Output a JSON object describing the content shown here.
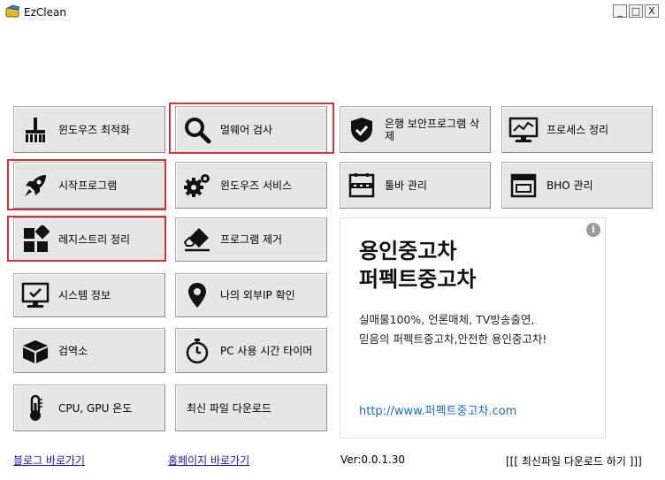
{
  "window": {
    "title": "EzClean",
    "minimize": "_",
    "maximize": "□",
    "close": "X"
  },
  "menu": {
    "optimize": "윈도우즈 최적화",
    "malware": "멀웨어 검사",
    "bank_security": "은행 보안프로그램 삭제",
    "process": "프로세스 정리",
    "startup": "시작프로그램",
    "services": "윈도우즈 서비스",
    "toolbar": "툴바 관리",
    "bho": "BHO 관리",
    "registry": "레지스트리 정리",
    "uninstall": "프로그램 제거",
    "sysinfo": "시스템 정보",
    "external_ip": "나의 외부IP 확인",
    "calculator": "검역소",
    "pc_timer": "PC 사용 시간 타이머",
    "temperature": "CPU, GPU 온도",
    "download_latest": "최신 파일 다운로드"
  },
  "ad": {
    "title_line1": "용인중고차",
    "title_line2": "퍼펙트중고차",
    "desc_line1": "실매물100%, 언론매체, TV방송출연,",
    "desc_line2": "믿음의 퍼펙트중고차,안전한 용인중고차!",
    "link": "http://www.퍼펙트중고차.com",
    "info_icon": "i"
  },
  "footer": {
    "blog_link": "블로그 바로가기",
    "homepage_link": "홈페이지 바로가기",
    "version": "Ver:0.0.1.30",
    "download_latest": "[[[ 최신파일 다운로드 하기 ]]]"
  },
  "colors": {
    "highlight": "#c9363c",
    "button_bg": "#e6e6e6",
    "link": "#1a1aa6",
    "ad_link": "#1f6fb8"
  },
  "icons": {
    "optimize": "broom-icon",
    "malware": "magnifier-icon",
    "bank_security": "shield-check-icon",
    "process": "monitor-chart-icon",
    "startup": "rocket-icon",
    "services": "gears-icon",
    "toolbar": "toolbar-icon",
    "bho": "browser-window-icon",
    "registry": "blocks-icon",
    "uninstall": "eraser-icon",
    "sysinfo": "monitor-check-icon",
    "external_ip": "location-pin-icon",
    "calculator": "box-icon",
    "pc_timer": "stopwatch-icon",
    "temperature": "thermometer-icon"
  }
}
